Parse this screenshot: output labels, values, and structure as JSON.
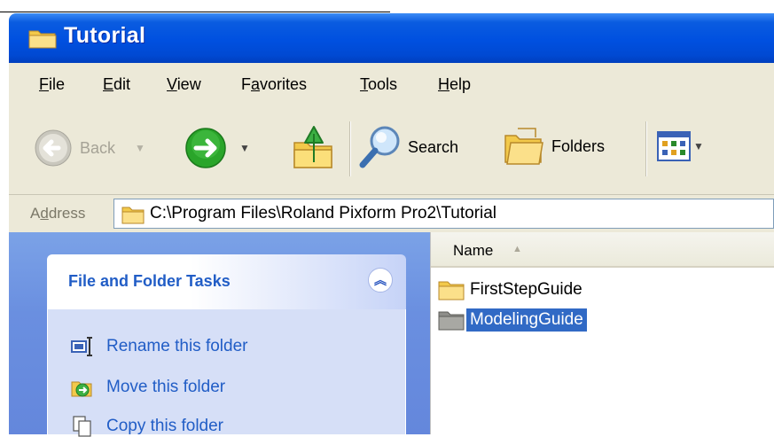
{
  "window": {
    "title": "Tutorial"
  },
  "menu": {
    "items": [
      {
        "pre": "",
        "ul": "F",
        "post": "ile"
      },
      {
        "pre": "",
        "ul": "E",
        "post": "dit"
      },
      {
        "pre": "",
        "ul": "V",
        "post": "iew"
      },
      {
        "pre": "F",
        "ul": "a",
        "post": "vorites"
      },
      {
        "pre": "",
        "ul": "T",
        "post": "ools"
      },
      {
        "pre": "",
        "ul": "H",
        "post": "elp"
      }
    ]
  },
  "toolbar": {
    "back_label": "Back",
    "search_label": "Search",
    "folders_label": "Folders"
  },
  "address": {
    "label_pre": "A",
    "label_ul": "d",
    "label_post": "dress",
    "value": "C:\\Program Files\\Roland Pixform Pro2\\Tutorial"
  },
  "tasks": {
    "title": "File and Folder Tasks",
    "items": [
      {
        "label": "Rename this folder",
        "icon": "rename-icon"
      },
      {
        "label": "Move this folder",
        "icon": "move-icon"
      },
      {
        "label": "Copy this folder",
        "icon": "copy-icon"
      }
    ]
  },
  "files": {
    "column_name": "Name",
    "items": [
      {
        "name": "FirstStepGuide",
        "selected": false
      },
      {
        "name": "ModelingGuide",
        "selected": true
      }
    ]
  },
  "colors": {
    "titlebar": "#0054e3",
    "selection": "#316ac5",
    "task_link": "#215dc6"
  }
}
